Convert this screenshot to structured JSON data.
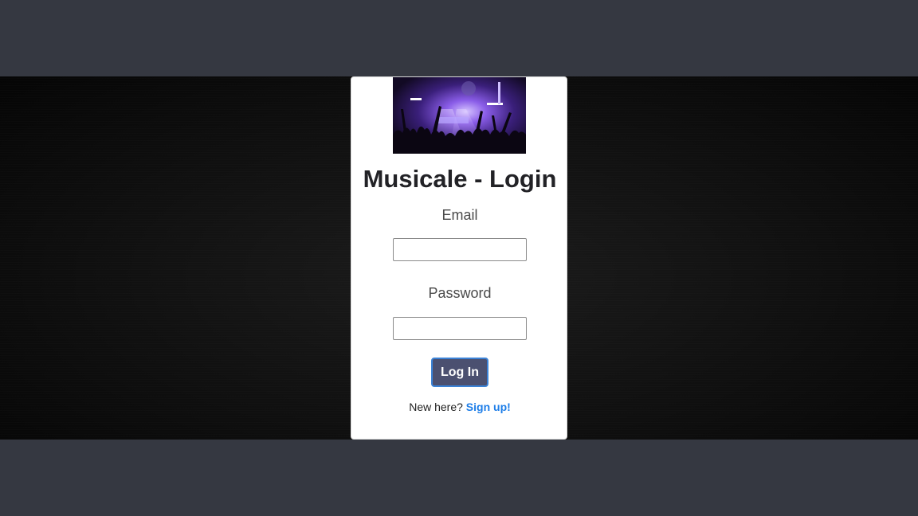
{
  "login": {
    "hero_image": "concert-crowd-image",
    "title": "Musicale - Login",
    "email_label": "Email",
    "email_value": "",
    "email_placeholder": "",
    "password_label": "Password",
    "password_value": "",
    "password_placeholder": "",
    "login_button_label": "Log In",
    "signup_prompt": "New here?",
    "signup_link_label": "Sign up!"
  },
  "colors": {
    "page_band": "#353841",
    "stage_background": "#121212",
    "card_background": "#ffffff",
    "button_background": "#4b5070",
    "button_border": "#3b82d6",
    "link": "#1e7ee8"
  }
}
